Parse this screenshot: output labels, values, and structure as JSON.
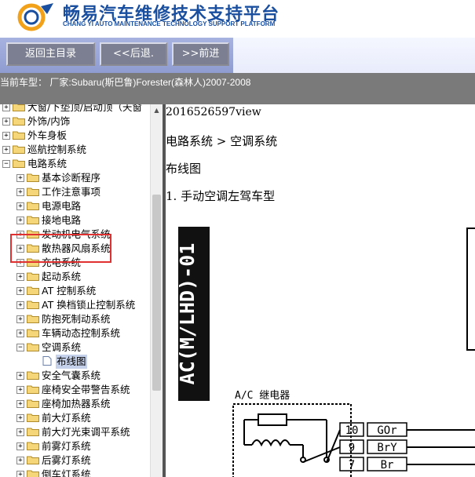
{
  "header": {
    "title": "畅易汽车维修技术支持平台",
    "subtitle": "CHANG YI AUTO MAINTENANCE TECHNOLOGY SUPPORT PLATFORM"
  },
  "toolbar": {
    "home_label": "返回主目录",
    "back_label": "<<后退.",
    "forward_label": ">>前进"
  },
  "vehicle": {
    "text": "当前车型： 厂家:Subaru(斯巴鲁)Forester(森林人)2007-2008"
  },
  "tree": {
    "items": [
      {
        "label": "大窗/下垫顶/启动顶（天窗",
        "level": 0
      },
      {
        "label": "外饰/内饰",
        "level": 0
      },
      {
        "label": "外车身板",
        "level": 0
      },
      {
        "label": "巡航控制系统",
        "level": 0
      },
      {
        "label": "电路系统",
        "level": 0
      },
      {
        "label": "基本诊断程序",
        "level": 1
      },
      {
        "label": "工作注意事项",
        "level": 1
      },
      {
        "label": "电源电路",
        "level": 1
      },
      {
        "label": "接地电路",
        "level": 1
      },
      {
        "label": "发动机电气系统",
        "level": 1
      },
      {
        "label": "散热器风扇系统",
        "level": 1
      },
      {
        "label": "充电系统",
        "level": 1
      },
      {
        "label": "起动系统",
        "level": 1
      },
      {
        "label": "AT 控制系统",
        "level": 1
      },
      {
        "label": "AT 换档锁止控制系统",
        "level": 1
      },
      {
        "label": "防抱死制动系统",
        "level": 1
      },
      {
        "label": "车辆动态控制系统",
        "level": 1
      },
      {
        "label": "空调系统",
        "level": 1
      },
      {
        "label": "布线图",
        "level": 2
      },
      {
        "label": "安全气囊系统",
        "level": 1
      },
      {
        "label": "座椅安全带警告系统",
        "level": 1
      },
      {
        "label": "座椅加热器系统",
        "level": 1
      },
      {
        "label": "前大灯系统",
        "level": 1
      },
      {
        "label": "前大灯光束调平系统",
        "level": 1
      },
      {
        "label": "前雾灯系统",
        "level": 1
      },
      {
        "label": "后雾灯系统",
        "level": 1
      },
      {
        "label": "倒车灯系统",
        "level": 1
      }
    ]
  },
  "content": {
    "doc_id": "2016526597view",
    "breadcrumb": "电路系统 > 空调系统",
    "section": "布线图",
    "heading": "1. 手动空调左驾车型",
    "diagram": {
      "vertical_label": "AC(M/LHD)-01",
      "relay_label": "A/C 继电器",
      "pins": [
        {
          "num": "10",
          "wire": "GOr"
        },
        {
          "num": "9",
          "wire": "BrY"
        },
        {
          "num": "7",
          "wire": "Br"
        }
      ]
    }
  },
  "colors": {
    "title_blue": "#1a4fa0",
    "toolbar_bg": "#9aa7d6",
    "button_bg": "#7b7f91",
    "vehicle_bar": "#7a7a7a",
    "highlight": "#e0302f",
    "selected_bg": "#c5d1ea"
  }
}
